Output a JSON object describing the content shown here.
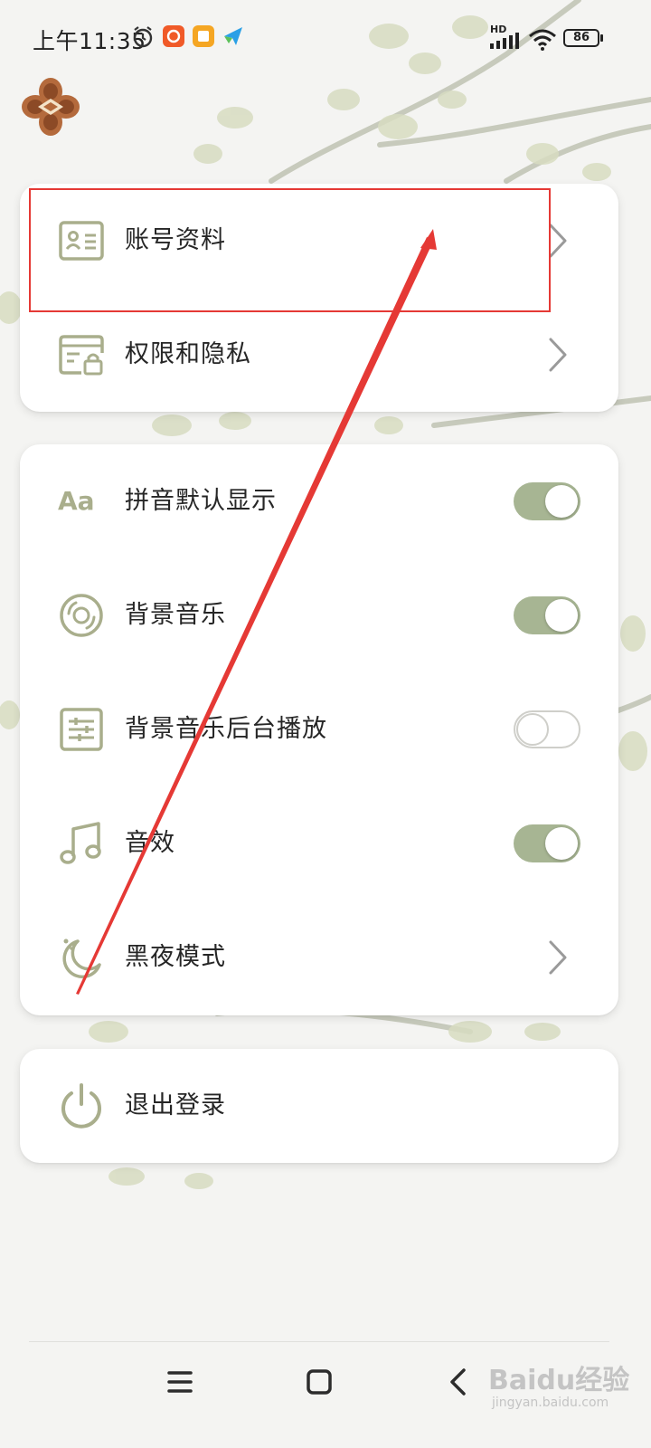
{
  "status_bar": {
    "time": "上午11:35",
    "battery": "86",
    "network_label": "HD"
  },
  "account_section": {
    "items": [
      {
        "label": "账号资料",
        "icon": "profile-card-icon"
      },
      {
        "label": "权限和隐私",
        "icon": "privacy-lock-icon"
      }
    ]
  },
  "settings_section": {
    "pinyin_icon_text": "Aa",
    "items": [
      {
        "label": "拼音默认显示",
        "icon": "pinyin-icon",
        "toggle": true
      },
      {
        "label": "背景音乐",
        "icon": "music-disc-icon",
        "toggle": true
      },
      {
        "label": "背景音乐后台播放",
        "icon": "settings-sliders-icon",
        "toggle": false
      },
      {
        "label": "音效",
        "icon": "music-note-icon",
        "toggle": true
      },
      {
        "label": "黑夜模式",
        "icon": "moon-icon"
      }
    ]
  },
  "logout_section": {
    "label": "退出登录",
    "icon": "power-icon"
  },
  "watermark": {
    "main": "Baidu经验",
    "sub": "jingyan.baidu.com"
  },
  "colors": {
    "accent": "#a7b593",
    "icon": "#a9ae8c",
    "annotation": "#e53935"
  }
}
